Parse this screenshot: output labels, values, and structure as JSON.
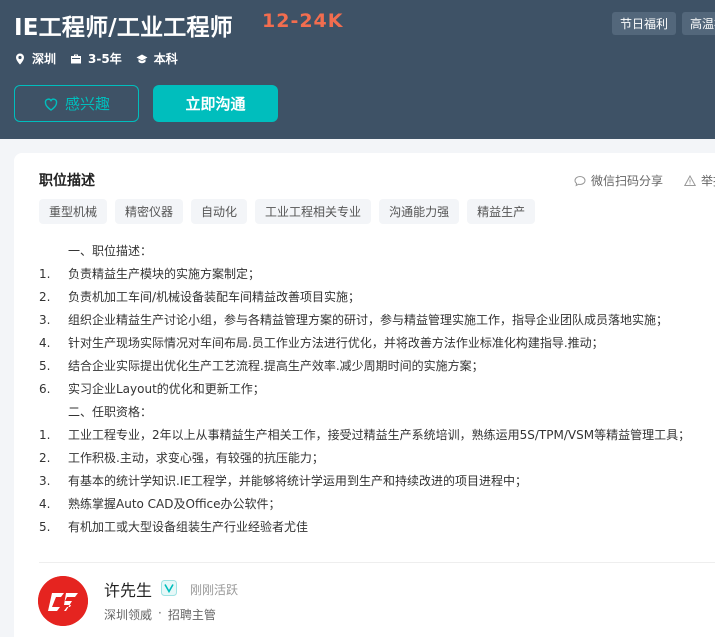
{
  "header": {
    "job_title": "IE工程师/工业工程师",
    "salary": "12-24K",
    "benefits": [
      "节日福利",
      "高温补"
    ],
    "meta": {
      "location": "深圳",
      "experience": "3-5年",
      "education": "本科"
    },
    "interest_label": "感兴趣",
    "chat_label": "立即沟通"
  },
  "detail": {
    "section_title": "职位描述",
    "share_label": "微信扫码分享",
    "report_label": "举报",
    "skills": [
      "重型机械",
      "精密仪器",
      "自动化",
      "工业工程相关专业",
      "沟通能力强",
      "精益生产"
    ],
    "description": [
      {
        "num": "",
        "text": "一、职位描述："
      },
      {
        "num": "1.",
        "text": "负责精益生产模块的实施方案制定；"
      },
      {
        "num": "2.",
        "text": "负责机加工车间/机械设备装配车间精益改善项目实施；"
      },
      {
        "num": "3.",
        "text": "组织企业精益生产讨论小组，参与各精益管理方案的研讨，参与精益管理实施工作，指导企业团队成员落地实施；"
      },
      {
        "num": "4.",
        "text": "针对生产现场实际情况对车间布局.员工作业方法进行优化，并将改善方法作业标准化构建指导.推动；"
      },
      {
        "num": "5.",
        "text": "结合企业实际提出优化生产工艺流程.提高生产效率.减少周期时间的实施方案；"
      },
      {
        "num": "6.",
        "text": "实习企业Layout的优化和更新工作；"
      },
      {
        "num": "",
        "text": "二、任职资格："
      },
      {
        "num": "1.",
        "text": "工业工程专业，2年以上从事精益生产相关工作，接受过精益生产系统培训，熟练运用5S/TPM/VSM等精益管理工具；"
      },
      {
        "num": "2.",
        "text": "工作积极.主动，求变心强，有较强的抗压能力；"
      },
      {
        "num": "3.",
        "text": "有基本的统计学知识.IE工程学，并能够将统计学运用到生产和持续改进的项目进程中；"
      },
      {
        "num": "4.",
        "text": "熟练掌握Auto CAD及Office办公软件；"
      },
      {
        "num": "5.",
        "text": "有机加工或大型设备组装生产行业经验者尤佳"
      }
    ]
  },
  "recruiter": {
    "name": "许先生",
    "status": "刚刚活跃",
    "company": "深圳领威",
    "separator": "·",
    "role": "招聘主管"
  },
  "colors": {
    "header_bg": "#3e5266",
    "accent": "#00bebd",
    "salary": "#f26d4f"
  }
}
